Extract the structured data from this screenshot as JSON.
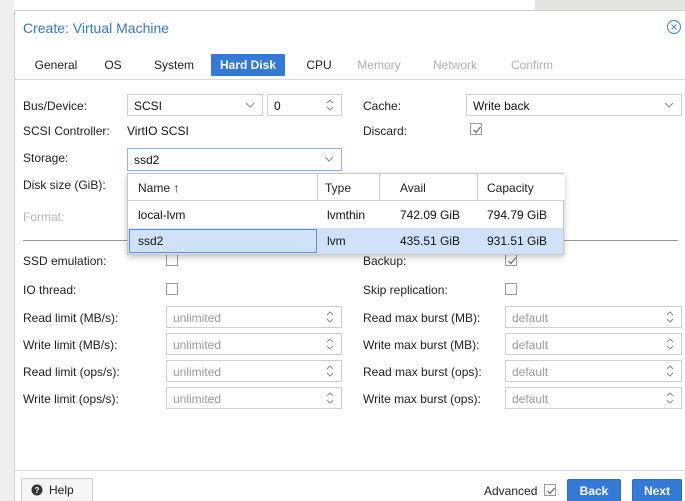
{
  "dialog": {
    "title": "Create: Virtual Machine"
  },
  "tabs": [
    {
      "label": "General",
      "state": "normal"
    },
    {
      "label": "OS",
      "state": "normal"
    },
    {
      "label": "System",
      "state": "normal"
    },
    {
      "label": "Hard Disk",
      "state": "active"
    },
    {
      "label": "CPU",
      "state": "normal"
    },
    {
      "label": "Memory",
      "state": "disabled"
    },
    {
      "label": "Network",
      "state": "disabled"
    },
    {
      "label": "Confirm",
      "state": "disabled"
    }
  ],
  "form": {
    "bus_device_label": "Bus/Device:",
    "bus_value": "SCSI",
    "device_index": "0",
    "scsi_controller_label": "SCSI Controller:",
    "scsi_controller_value": "VirtIO SCSI",
    "storage_label": "Storage:",
    "storage_value": "ssd2",
    "disk_size_label": "Disk size (GiB):",
    "format_label": "Format:",
    "cache_label": "Cache:",
    "cache_value": "Write back",
    "discard_label": "Discard:",
    "discard_checked": true
  },
  "storage_dropdown": {
    "columns": [
      "Name ↑",
      "Type",
      "Avail",
      "Capacity"
    ],
    "rows": [
      {
        "name": "local-lvm",
        "type": "lvmthin",
        "avail": "742.09 GiB",
        "capacity": "794.79 GiB",
        "selected": false
      },
      {
        "name": "ssd2",
        "type": "lvm",
        "avail": "435.51 GiB",
        "capacity": "931.51 GiB",
        "selected": true
      }
    ]
  },
  "advanced": {
    "ssd_emulation_label": "SSD emulation:",
    "ssd_emulation_checked": false,
    "io_thread_label": "IO thread:",
    "io_thread_checked": false,
    "backup_label": "Backup:",
    "backup_checked": true,
    "skip_replication_label": "Skip replication:",
    "skip_replication_checked": false,
    "read_limit_mb_label": "Read limit (MB/s):",
    "write_limit_mb_label": "Write limit (MB/s):",
    "read_limit_ops_label": "Read limit (ops/s):",
    "write_limit_ops_label": "Write limit (ops/s):",
    "read_max_burst_mb_label": "Read max burst (MB):",
    "write_max_burst_mb_label": "Write max burst (MB):",
    "read_max_burst_ops_label": "Read max burst (ops):",
    "write_max_burst_ops_label": "Write max burst (ops):",
    "limit_placeholder": "unlimited",
    "burst_placeholder": "default"
  },
  "footer": {
    "help_label": "Help",
    "advanced_label": "Advanced",
    "advanced_checked": true,
    "back_label": "Back",
    "next_label": "Next"
  },
  "colors": {
    "accent": "#3579d6",
    "selected_row": "#cfe2f7",
    "title": "#3579c6"
  },
  "icons": [
    "close-circle-icon",
    "chevron-down-icon",
    "spinner-icon",
    "checkbox-icon",
    "question-circle-icon",
    "sort-asc-icon"
  ]
}
